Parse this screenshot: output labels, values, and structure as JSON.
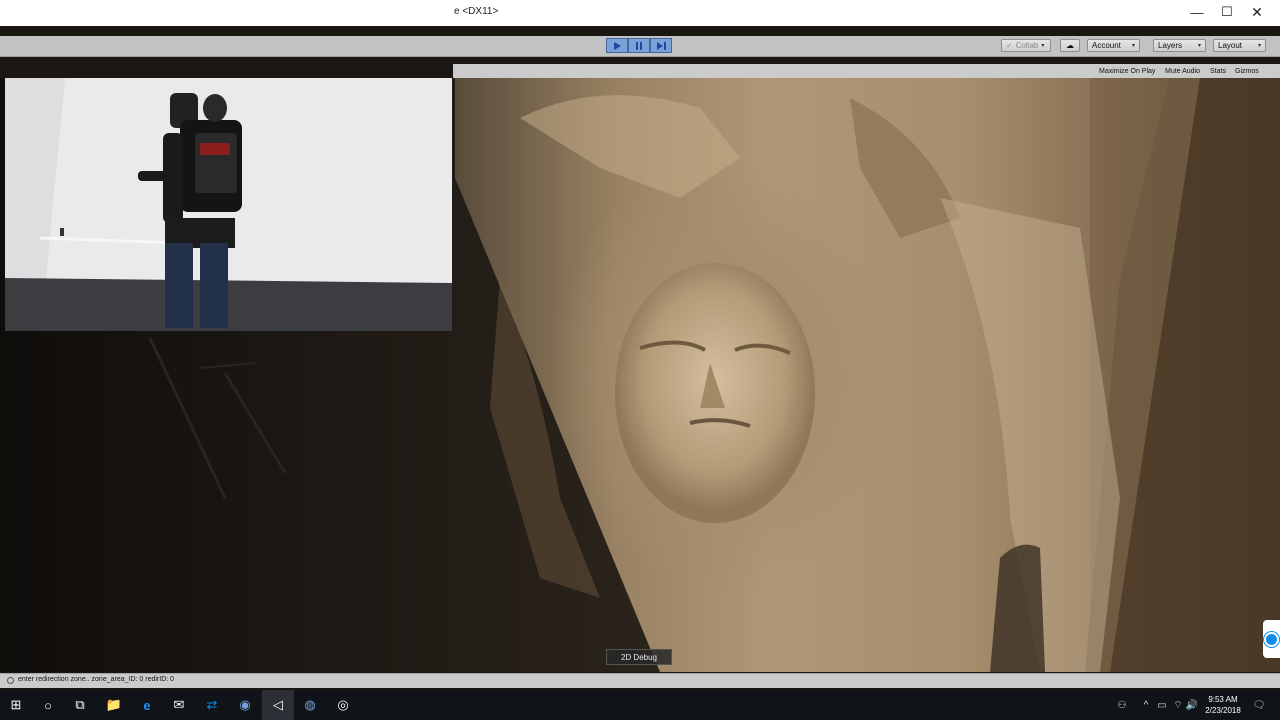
{
  "window": {
    "title_fragment": "e <DX11>",
    "minimize_glyph": "—",
    "maximize_glyph": "☐",
    "close_glyph": "✕"
  },
  "toolbar": {
    "play_icon": "play-icon",
    "pause_icon": "pause-icon",
    "step_icon": "step-icon",
    "collab_label": "Collab",
    "account_label": "Account",
    "layers_label": "Layers",
    "layout_label": "Layout",
    "caret": "▾",
    "check_glyph": "✓",
    "cloud_glyph": "☁"
  },
  "game_view": {
    "options": [
      "Maximize On Play",
      "Mute Audio",
      "Stats",
      "Gizmos"
    ],
    "debug_button": "2D Debug"
  },
  "status": {
    "message": "enter redirection zone.. zone_area_ID: 0 redirID: 0"
  },
  "taskbar": {
    "start_glyph": "⊞",
    "search_glyph": "○",
    "taskview_glyph": "⧉",
    "apps": [
      {
        "name": "file-explorer-icon",
        "glyph": "📁",
        "color": "#f2c14e"
      },
      {
        "name": "edge-icon",
        "glyph": "e",
        "color": "#1e90ff"
      },
      {
        "name": "mail-icon",
        "glyph": "✉",
        "color": "#ffffff"
      },
      {
        "name": "teamviewer-icon",
        "glyph": "⇄",
        "color": "#0e8ee9"
      },
      {
        "name": "steamvr-icon",
        "glyph": "◉",
        "color": "#7aa0d8"
      },
      {
        "name": "unity-icon",
        "glyph": "◁",
        "color": "#ffffff"
      },
      {
        "name": "vive-icon",
        "glyph": "◍",
        "color": "#7aa0d8"
      },
      {
        "name": "obs-icon",
        "glyph": "◎",
        "color": "#ffffff"
      }
    ],
    "tray": {
      "people_glyph": "⚇",
      "chevron_glyph": "^",
      "battery_glyph": "▭",
      "network_glyph": "⌔",
      "volume_glyph": "🔊",
      "notification_glyph": "🗨"
    },
    "time": "9:53 AM",
    "date": "2/23/2018"
  },
  "colors": {
    "toolbar_bg": "#c2c2c2",
    "play_active": "#7aa2d8",
    "taskbar_bg": "#101418",
    "teamviewer_blue": "#0e8ee9"
  }
}
